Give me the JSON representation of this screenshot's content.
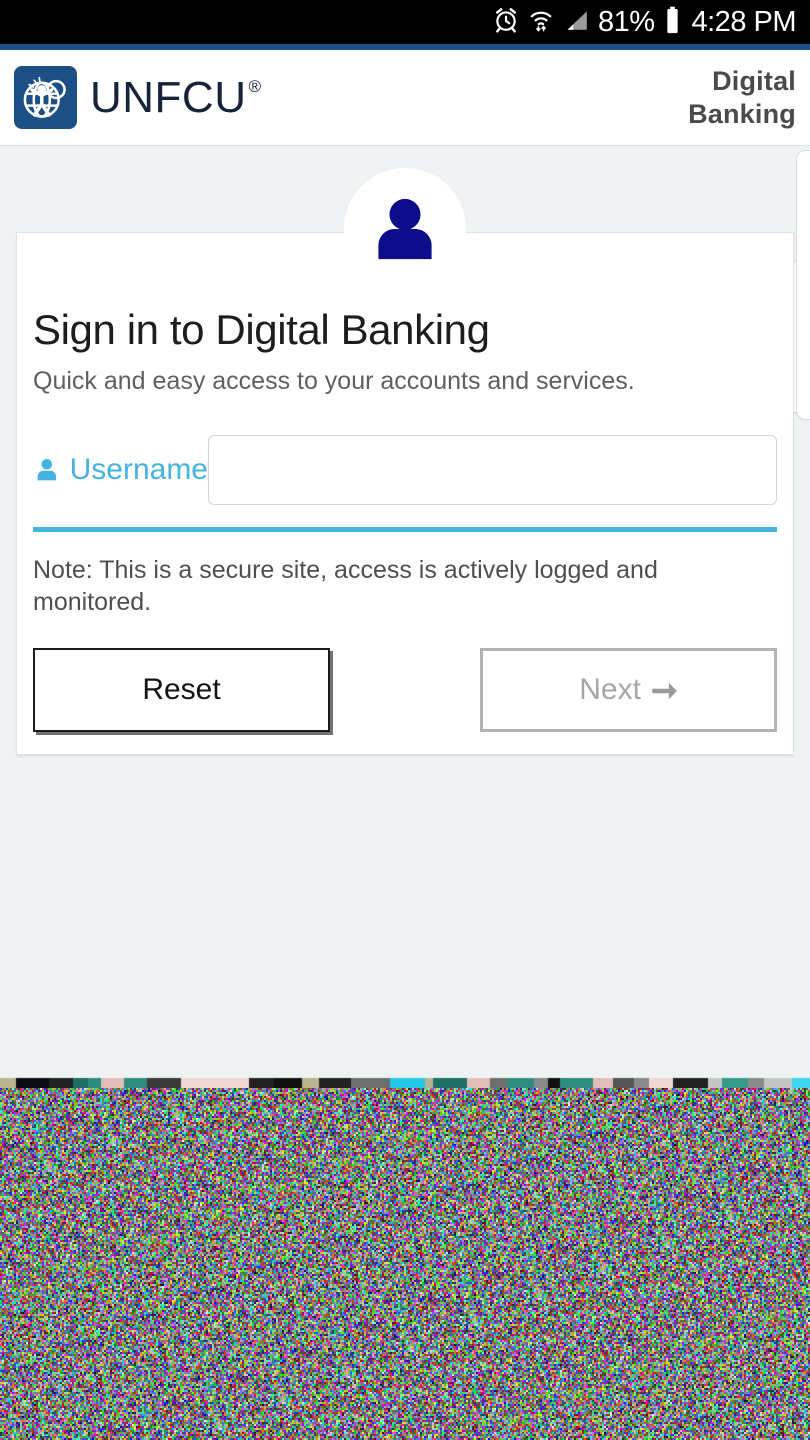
{
  "statusbar": {
    "icons": [
      "alarm-clock-icon",
      "wifi-icon",
      "cell-signal-icon",
      "battery-icon"
    ],
    "battery_percent": "81%",
    "time": "4:28 PM"
  },
  "header": {
    "logo_icon": "unfcu-globe-logo",
    "wordmark": "UNFCU",
    "registered_mark": "®",
    "label_line1": "Digital",
    "label_line2": "Banking"
  },
  "main": {
    "avatar_icon": "user-avatar-icon",
    "title": "Sign in to Digital Banking",
    "subtitle": "Quick and easy access to your accounts and services.",
    "form": {
      "username_icon": "person-icon",
      "username_label": "Username",
      "username_value": "",
      "username_placeholder": ""
    },
    "note": "Note: This is a secure site, access is actively logged and monitored.",
    "buttons": {
      "reset_label": "Reset",
      "next_label": "Next",
      "next_arrow_icon": "arrow-right-icon"
    }
  },
  "colors": {
    "brand_navy": "#1d4f87",
    "accent_blue": "#45b3e0",
    "avatar_navy": "#0d0d8c",
    "page_bg": "#eef2f3",
    "status_bar_bg": "#000000",
    "top_rule": "#1d4f8c"
  }
}
